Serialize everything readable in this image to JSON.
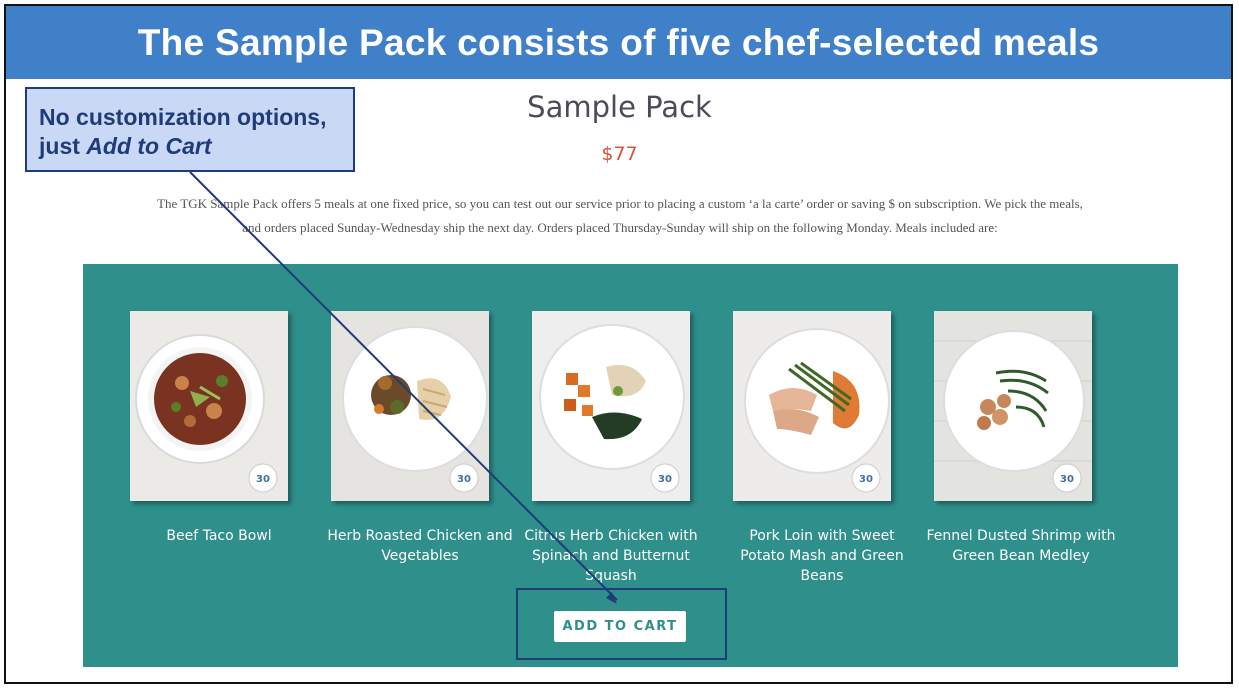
{
  "banner": {
    "title": "The Sample Pack consists of five chef-selected meals"
  },
  "callout": {
    "text_main": "No customization options, just ",
    "text_emphasis": "Add to Cart"
  },
  "product": {
    "title": "Sample Pack",
    "price": "$77",
    "description": "The TGK Sample Pack offers 5 meals at one fixed price, so you can test out our service prior to placing a custom ‘a la carte’ order or saving $ on subscription. We pick the meals, and orders placed Sunday-Wednesday ship the next day. Orders placed Thursday-Sunday will ship on the following Monday. Meals included are:"
  },
  "meals": [
    {
      "name": "Beef Taco Bowl",
      "badge": "WHOLE 30"
    },
    {
      "name": "Herb Roasted Chicken and Vegetables",
      "badge": "WHOLE 30"
    },
    {
      "name": "Citrus Herb Chicken with Spinach and Butternut Squash",
      "badge": "WHOLE 30"
    },
    {
      "name": "Pork Loin with Sweet Potato Mash and Green Beans",
      "badge": "WHOLE 30"
    },
    {
      "name": "Fennel Dusted Shrimp with Green Bean Medley",
      "badge": "WHOLE 30"
    }
  ],
  "actions": {
    "add_to_cart_label": "ADD TO CART"
  },
  "colors": {
    "banner": "#3f80c8",
    "panel": "#2e8f8b",
    "price": "#d85338",
    "callout_fill": "#c9d9f5",
    "callout_border": "#1f3b7a"
  }
}
